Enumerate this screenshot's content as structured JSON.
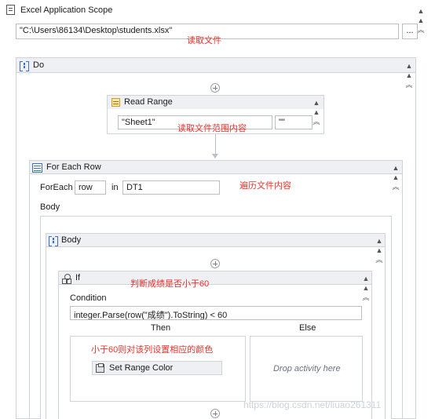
{
  "excel_scope": {
    "title": "Excel Application Scope",
    "path_value": "\"C:\\Users\\86134\\Desktop\\students.xlsx\"",
    "browse_label": "...",
    "note": "读取文件"
  },
  "do": {
    "title": "Do"
  },
  "read_range": {
    "title": "Read Range",
    "sheet_value": "\"Sheet1\"",
    "range_value": "\"\"",
    "note": "读取文件范围内容"
  },
  "for_each_row": {
    "title": "For Each Row",
    "foreach_label": "ForEach",
    "item_value": "row",
    "in_label": "in",
    "collection_value": "DT1",
    "note": "遍历文件内容",
    "body_label": "Body"
  },
  "body": {
    "title": "Body"
  },
  "if_activity": {
    "title": "If",
    "note": "判断成绩是否小于60",
    "condition_label": "Condition",
    "condition_value": "integer.Parse(row(\"成绩\").ToString) < 60",
    "then_label": "Then",
    "else_label": "Else",
    "then_note": "小于60则对该列设置相应的颜色",
    "set_range_color": "Set Range Color",
    "drop_placeholder": "Drop activity here"
  },
  "watermark": "https://blog.csdn.net/liuao261311",
  "colors": {
    "note_red": "#e8322c",
    "header_bg": "#eef0f4",
    "border": "#cfd4dc",
    "icon_blue": "#3a6fc4"
  }
}
